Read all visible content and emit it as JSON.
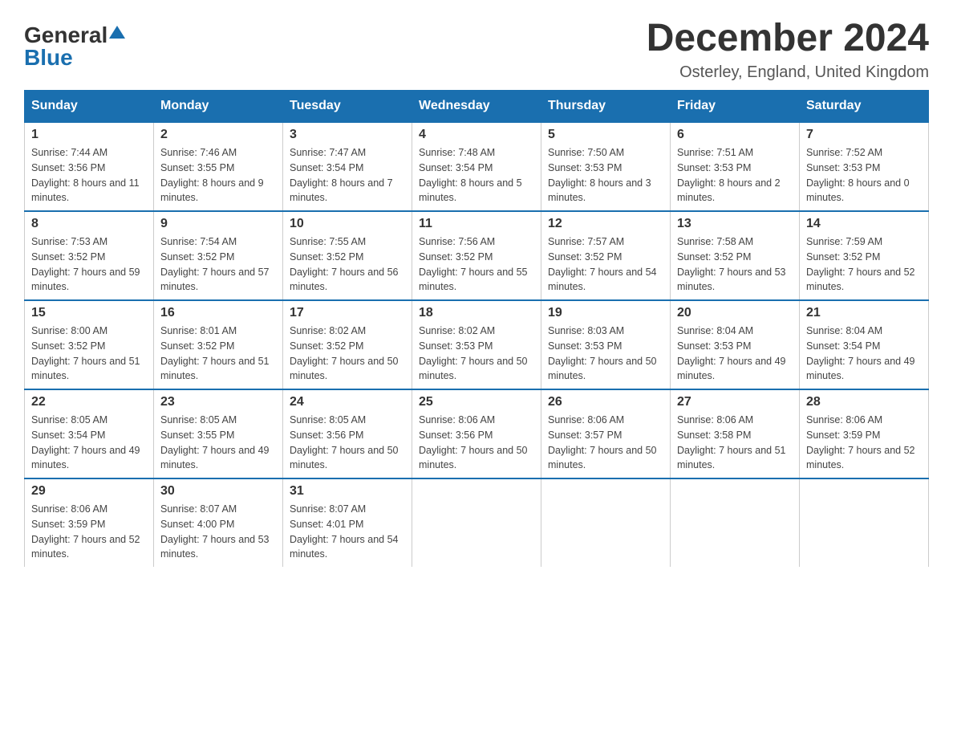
{
  "header": {
    "logo_general": "General",
    "logo_blue": "Blue",
    "month_year": "December 2024",
    "location": "Osterley, England, United Kingdom"
  },
  "weekdays": [
    "Sunday",
    "Monday",
    "Tuesday",
    "Wednesday",
    "Thursday",
    "Friday",
    "Saturday"
  ],
  "weeks": [
    [
      {
        "day": "1",
        "sunrise": "7:44 AM",
        "sunset": "3:56 PM",
        "daylight": "8 hours and 11 minutes."
      },
      {
        "day": "2",
        "sunrise": "7:46 AM",
        "sunset": "3:55 PM",
        "daylight": "8 hours and 9 minutes."
      },
      {
        "day": "3",
        "sunrise": "7:47 AM",
        "sunset": "3:54 PM",
        "daylight": "8 hours and 7 minutes."
      },
      {
        "day": "4",
        "sunrise": "7:48 AM",
        "sunset": "3:54 PM",
        "daylight": "8 hours and 5 minutes."
      },
      {
        "day": "5",
        "sunrise": "7:50 AM",
        "sunset": "3:53 PM",
        "daylight": "8 hours and 3 minutes."
      },
      {
        "day": "6",
        "sunrise": "7:51 AM",
        "sunset": "3:53 PM",
        "daylight": "8 hours and 2 minutes."
      },
      {
        "day": "7",
        "sunrise": "7:52 AM",
        "sunset": "3:53 PM",
        "daylight": "8 hours and 0 minutes."
      }
    ],
    [
      {
        "day": "8",
        "sunrise": "7:53 AM",
        "sunset": "3:52 PM",
        "daylight": "7 hours and 59 minutes."
      },
      {
        "day": "9",
        "sunrise": "7:54 AM",
        "sunset": "3:52 PM",
        "daylight": "7 hours and 57 minutes."
      },
      {
        "day": "10",
        "sunrise": "7:55 AM",
        "sunset": "3:52 PM",
        "daylight": "7 hours and 56 minutes."
      },
      {
        "day": "11",
        "sunrise": "7:56 AM",
        "sunset": "3:52 PM",
        "daylight": "7 hours and 55 minutes."
      },
      {
        "day": "12",
        "sunrise": "7:57 AM",
        "sunset": "3:52 PM",
        "daylight": "7 hours and 54 minutes."
      },
      {
        "day": "13",
        "sunrise": "7:58 AM",
        "sunset": "3:52 PM",
        "daylight": "7 hours and 53 minutes."
      },
      {
        "day": "14",
        "sunrise": "7:59 AM",
        "sunset": "3:52 PM",
        "daylight": "7 hours and 52 minutes."
      }
    ],
    [
      {
        "day": "15",
        "sunrise": "8:00 AM",
        "sunset": "3:52 PM",
        "daylight": "7 hours and 51 minutes."
      },
      {
        "day": "16",
        "sunrise": "8:01 AM",
        "sunset": "3:52 PM",
        "daylight": "7 hours and 51 minutes."
      },
      {
        "day": "17",
        "sunrise": "8:02 AM",
        "sunset": "3:52 PM",
        "daylight": "7 hours and 50 minutes."
      },
      {
        "day": "18",
        "sunrise": "8:02 AM",
        "sunset": "3:53 PM",
        "daylight": "7 hours and 50 minutes."
      },
      {
        "day": "19",
        "sunrise": "8:03 AM",
        "sunset": "3:53 PM",
        "daylight": "7 hours and 50 minutes."
      },
      {
        "day": "20",
        "sunrise": "8:04 AM",
        "sunset": "3:53 PM",
        "daylight": "7 hours and 49 minutes."
      },
      {
        "day": "21",
        "sunrise": "8:04 AM",
        "sunset": "3:54 PM",
        "daylight": "7 hours and 49 minutes."
      }
    ],
    [
      {
        "day": "22",
        "sunrise": "8:05 AM",
        "sunset": "3:54 PM",
        "daylight": "7 hours and 49 minutes."
      },
      {
        "day": "23",
        "sunrise": "8:05 AM",
        "sunset": "3:55 PM",
        "daylight": "7 hours and 49 minutes."
      },
      {
        "day": "24",
        "sunrise": "8:05 AM",
        "sunset": "3:56 PM",
        "daylight": "7 hours and 50 minutes."
      },
      {
        "day": "25",
        "sunrise": "8:06 AM",
        "sunset": "3:56 PM",
        "daylight": "7 hours and 50 minutes."
      },
      {
        "day": "26",
        "sunrise": "8:06 AM",
        "sunset": "3:57 PM",
        "daylight": "7 hours and 50 minutes."
      },
      {
        "day": "27",
        "sunrise": "8:06 AM",
        "sunset": "3:58 PM",
        "daylight": "7 hours and 51 minutes."
      },
      {
        "day": "28",
        "sunrise": "8:06 AM",
        "sunset": "3:59 PM",
        "daylight": "7 hours and 52 minutes."
      }
    ],
    [
      {
        "day": "29",
        "sunrise": "8:06 AM",
        "sunset": "3:59 PM",
        "daylight": "7 hours and 52 minutes."
      },
      {
        "day": "30",
        "sunrise": "8:07 AM",
        "sunset": "4:00 PM",
        "daylight": "7 hours and 53 minutes."
      },
      {
        "day": "31",
        "sunrise": "8:07 AM",
        "sunset": "4:01 PM",
        "daylight": "7 hours and 54 minutes."
      },
      null,
      null,
      null,
      null
    ]
  ]
}
